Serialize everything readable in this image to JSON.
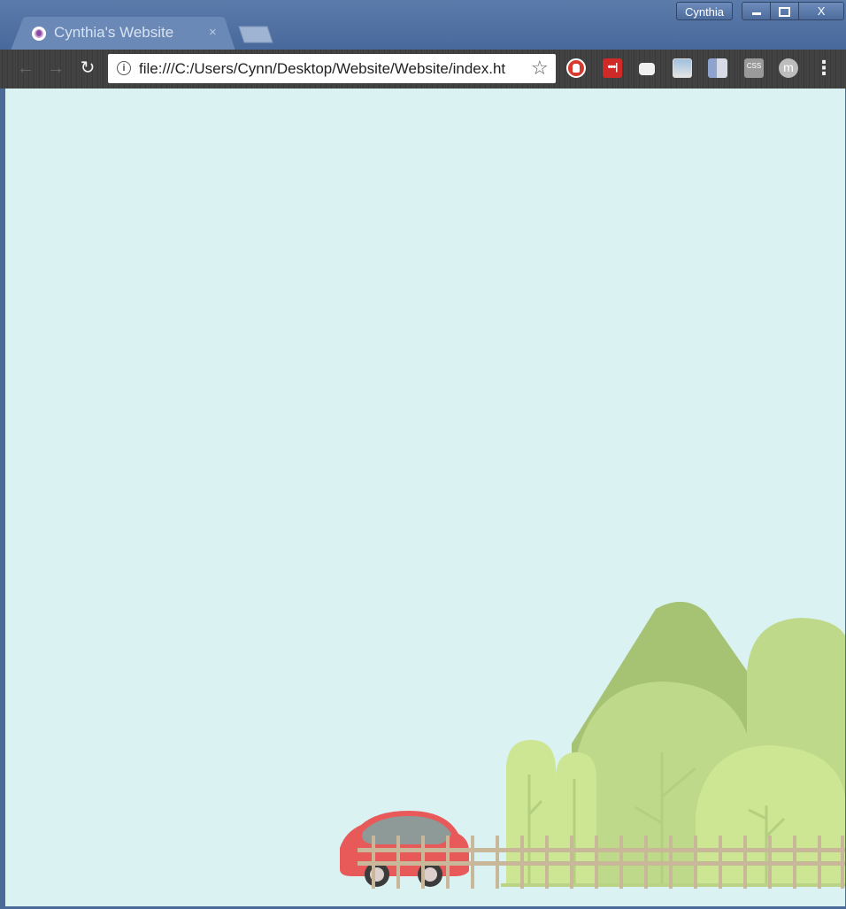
{
  "window": {
    "profile_name": "Cynthia",
    "controls": {
      "close_label": "X"
    }
  },
  "tab": {
    "title": "Cynthia's Website",
    "close_glyph": "×",
    "favicon": "avatar-favicon"
  },
  "toolbar": {
    "back_glyph": "←",
    "forward_glyph": "→",
    "reload_glyph": "↻",
    "menu_glyph": "⋮"
  },
  "address_bar": {
    "url": "file:///C:/Users/Cynn/Desktop/Website/Website/index.ht",
    "info_glyph": "i",
    "star_glyph": "☆"
  },
  "extensions": [
    {
      "icon": "stop-hand-icon"
    },
    {
      "icon": "lastpass-icon",
      "label": "•••|"
    },
    {
      "icon": "chat-bubble-icon"
    },
    {
      "icon": "photo-icon"
    },
    {
      "icon": "figure-icon"
    },
    {
      "icon": "css-icon",
      "label": "CSS"
    },
    {
      "icon": "profile-m-icon",
      "label": "m"
    }
  ],
  "page": {
    "background": "#dbf2f2",
    "scene": {
      "car_color": "#e85a5a",
      "mountain_color": "#a6c273",
      "tree_colors": [
        "#bfd98a",
        "#cde694"
      ],
      "fence_color": "#c9b79a"
    }
  }
}
